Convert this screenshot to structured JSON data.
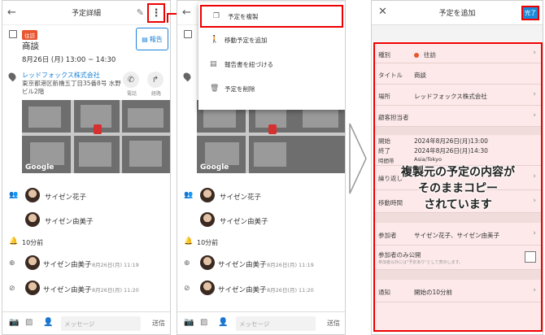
{
  "detail": {
    "title": "予定詳細",
    "badge": "往訪",
    "subject": "商談",
    "datetime": "8月26日 (月) 13:00 ~ 14:30",
    "report_label": "報告",
    "company": "レッドフォックス株式会社",
    "address": "東京都港区新橋五丁目35番8号 水野ビル2階",
    "phone_label": "電話",
    "route_label": "経路",
    "map_logo": "Google",
    "participants": [
      "サイゼン花子",
      "サイゼン由美子"
    ],
    "reminder": "10分前",
    "history": [
      {
        "name": "サイゼン由美子",
        "date": "8月26日(月) 11:19"
      },
      {
        "name": "サイゼン由美子",
        "date": "8月26日(月) 11:20"
      }
    ],
    "message_placeholder": "メッセージ",
    "send_label": "送信"
  },
  "menu": {
    "items": [
      "予定を複製",
      "移動予定を追加",
      "報告書を紐づける",
      "予定を削除"
    ]
  },
  "form": {
    "title": "予定を追加",
    "done_label": "完了",
    "rows": [
      {
        "key": "種別",
        "value": "往訪"
      },
      {
        "key": "タイトル",
        "value": "商談"
      },
      {
        "key": "場所",
        "value": "レッドフォックス株式会社"
      },
      {
        "key": "顧客担当者",
        "value": ""
      },
      {
        "key": "開始",
        "value": "2024年8月26日(月)13:00"
      },
      {
        "key": "終了",
        "value": "2024年8月26日(月)14:30"
      },
      {
        "key": "時間帯",
        "value": "Asia/Tokyo"
      },
      {
        "key": "繰り返し",
        "value": ""
      },
      {
        "key": "移動時間",
        "value": ""
      },
      {
        "key": "参加者",
        "value": "サイゼン花子、サイゼン由美子"
      },
      {
        "key": "参加者のみ公開",
        "value": "参加者以外には\"予定あり\"として表示します。"
      },
      {
        "key": "通知",
        "value": "開始の10分前"
      }
    ],
    "callout": [
      "複製元の予定の内容が",
      "そのままコピー",
      "されています"
    ]
  },
  "colors": {
    "accent": "#1c82d6",
    "highlight": "#ee0000",
    "badge": "#e8552f"
  }
}
